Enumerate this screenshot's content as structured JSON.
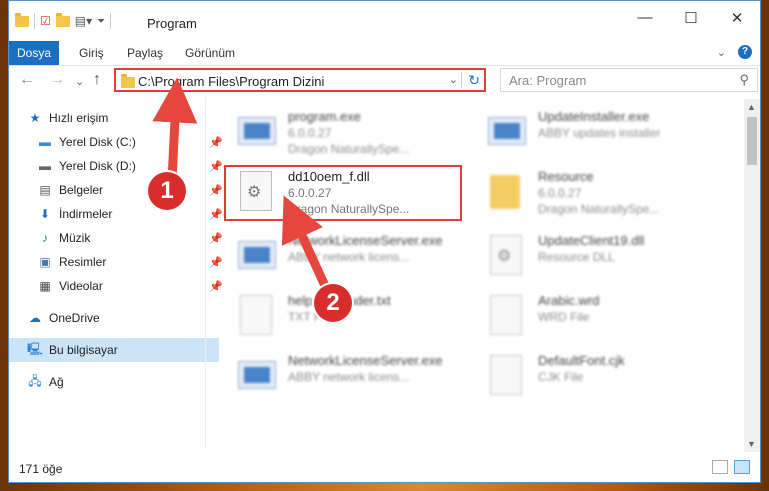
{
  "window": {
    "title": "Program"
  },
  "ribbon": {
    "tabs": [
      {
        "label": "Dosya",
        "active": true
      },
      {
        "label": "Giriş"
      },
      {
        "label": "Paylaş"
      },
      {
        "label": "Görünüm"
      }
    ]
  },
  "address": {
    "path": "C:\\Program Files\\Program Dizini"
  },
  "search": {
    "placeholder": "Ara: Program"
  },
  "sidebar": {
    "items": [
      {
        "label": "Hızlı erişim",
        "icon": "star-icon"
      },
      {
        "label": "Yerel Disk (C:)",
        "icon": "drive-icon",
        "pinned": true
      },
      {
        "label": "Yerel Disk (D:)",
        "icon": "drive-icon",
        "pinned": true
      },
      {
        "label": "Belgeler",
        "icon": "documents-icon",
        "pinned": true
      },
      {
        "label": "İndirmeler",
        "icon": "download-icon",
        "pinned": true
      },
      {
        "label": "Müzik",
        "icon": "music-icon",
        "pinned": true
      },
      {
        "label": "Resimler",
        "icon": "pictures-icon",
        "pinned": true
      },
      {
        "label": "Videolar",
        "icon": "videos-icon",
        "pinned": true
      },
      {
        "label": "OneDrive",
        "icon": "cloud-icon"
      },
      {
        "label": "Bu bilgisayar",
        "icon": "computer-icon",
        "selected": true
      },
      {
        "label": "Ağ",
        "icon": "network-icon"
      }
    ]
  },
  "files": [
    {
      "name": "program.exe",
      "line1": "6.0.0.27",
      "line2": "Dragon NaturallySpe...",
      "icon": "exe-icon"
    },
    {
      "name": "UpdateInstaller.exe",
      "line1": "ABBY updates installer",
      "line2": "",
      "icon": "exe-icon"
    },
    {
      "name": "dd10oem_f.dll",
      "line1": "6.0.0.27",
      "line2": "Dragon NaturallySpe...",
      "icon": "dll-gear-icon",
      "highlighted": true
    },
    {
      "name": "Resource",
      "line1": "6.0.0.27",
      "line2": "Dragon NaturallySpe...",
      "icon": "folder-icon"
    },
    {
      "name": "NetworkLicenseServer.exe",
      "line1": "ABBY network licens...",
      "line2": "",
      "icon": "exe-icon"
    },
    {
      "name": "UpdateClient19.dll",
      "line1": "Resource DLL",
      "line2": "",
      "icon": "dll-gear-icon"
    },
    {
      "name": "help.file.reader.txt",
      "line1": "TXT File",
      "line2": "",
      "icon": "document-icon"
    },
    {
      "name": "Arabic.wrd",
      "line1": "WRD File",
      "line2": "",
      "icon": "document-icon"
    },
    {
      "name": "NetworkLicenseServer.exe",
      "line1": "ABBY network licens...",
      "line2": "",
      "icon": "exe-icon"
    },
    {
      "name": "DefaultFont.cjk",
      "line1": "CJK File",
      "line2": "",
      "icon": "document-icon"
    }
  ],
  "status": {
    "count": "171 öğe"
  },
  "annotations": {
    "step1": "1",
    "step2": "2"
  },
  "colors": {
    "accent": "#1a6fc0",
    "highlight_border": "#e23b3b",
    "selection": "#cce4f7"
  }
}
